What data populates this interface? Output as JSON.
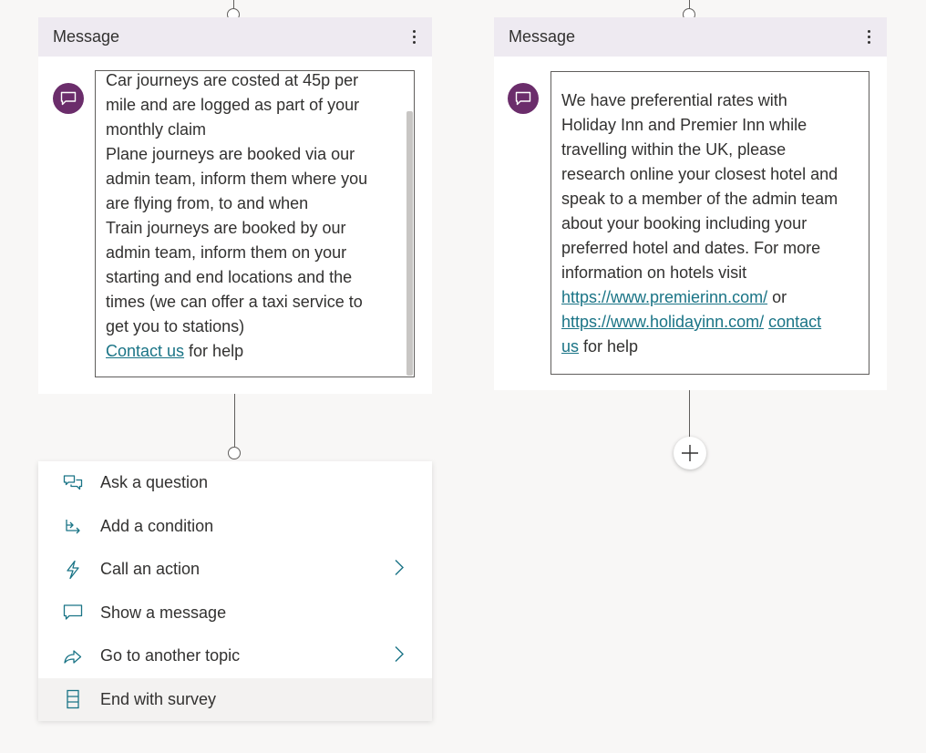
{
  "left_card": {
    "title": "Message",
    "text_lines": [
      "Car journeys are costed at 45p per",
      "mile and are logged as part of your",
      "monthly claim",
      "Plane journeys are booked via our",
      "admin team, inform them where you",
      "are flying from, to and when",
      "Train journeys are booked by our",
      "admin team, inform them on your",
      "starting and end locations and the",
      "times (we can offer a taxi service to",
      "get you to stations)"
    ],
    "link_text": "Contact us",
    "after_link": " for help"
  },
  "right_card": {
    "title": "Message",
    "text_lines": [
      "We have preferential rates with",
      "Holiday Inn and Premier Inn while",
      "travelling within the UK, please",
      "research online your closest hotel and",
      "speak to a member of the admin team",
      "about your booking including your",
      "preferred hotel and dates. For more",
      "information on hotels visit"
    ],
    "link1": "https://www.premierinn.com/",
    "or_text": " or",
    "link2": "https://www.holidayinn.com/",
    "link3a": "contact ",
    "link3b": "us",
    "after_link": " for help"
  },
  "menu": {
    "items": [
      {
        "label": "Ask a question",
        "icon": "ask-question-icon"
      },
      {
        "label": "Add a condition",
        "icon": "condition-icon"
      },
      {
        "label": "Call an action",
        "icon": "lightning-icon",
        "submenu": true
      },
      {
        "label": "Show a message",
        "icon": "message-icon"
      },
      {
        "label": "Go to another topic",
        "icon": "redirect-icon",
        "submenu": true
      },
      {
        "label": "End with survey",
        "icon": "survey-icon",
        "highlighted": true
      }
    ]
  },
  "colors": {
    "header_bg": "#eeeaf1",
    "avatar": "#6b2d6b",
    "link": "#1a7486",
    "icon_teal": "#1a7486"
  }
}
